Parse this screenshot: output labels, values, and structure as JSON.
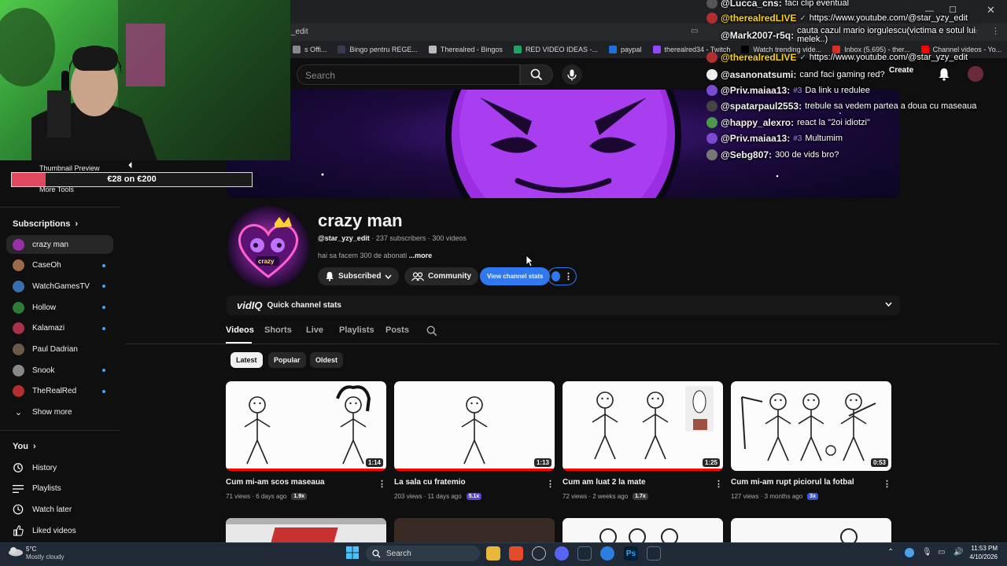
{
  "browser": {
    "tab_fragment": "_edit",
    "bookmarks": [
      {
        "label": "s Offi...",
        "color": "#888888"
      },
      {
        "label": "Bingo pentru REGE...",
        "color": "#3a3a55"
      },
      {
        "label": "Therealred - Bingos",
        "color": "#bbbbbb"
      },
      {
        "label": "RED VIDEO IDEAS -...",
        "color": "#1ea362"
      },
      {
        "label": "paypal",
        "color": "#1e6fd9"
      },
      {
        "label": "therealred34 - Twitch",
        "color": "#9146ff"
      },
      {
        "label": "Watch trending vide...",
        "color": "#000000"
      },
      {
        "label": "Inbox (5,695) - ther...",
        "color": "#d93025"
      },
      {
        "label": "Channel videos - Yo...",
        "color": "#ff0000"
      }
    ]
  },
  "header": {
    "search_placeholder": "Search",
    "create_label": "Create"
  },
  "chat": [
    {
      "user": "@Lucca_cns:",
      "msg": "faci clip eventual",
      "color": "#f1f1f1",
      "badge": ""
    },
    {
      "user": "@therealredLIVE",
      "msg": "https://www.youtube.com/@star_yzy_edit",
      "color": "#ffd400",
      "badge": "✓"
    },
    {
      "user": "@Mark2007-r5q:",
      "msg": "cauta cazul mario iorgulescu(victima e sotul lui melek..)",
      "color": "#f1f1f1",
      "badge": ""
    },
    {
      "user": "@therealredLIVE",
      "msg": "https://www.youtube.com/@star_yzy_edit",
      "color": "#ffd400",
      "badge": "✓"
    },
    {
      "user": "@asanonatsumi:",
      "msg": "cand faci gaming red?",
      "color": "#f1f1f1",
      "badge": ""
    },
    {
      "user": "@Priv.maiaa13:",
      "msg": "Da link u redulee",
      "color": "#f1f1f1",
      "badge": "#3"
    },
    {
      "user": "@spatarpaul2553:",
      "msg": "trebule sa vedem partea a doua cu maseaua",
      "color": "#f1f1f1",
      "badge": ""
    },
    {
      "user": "@happy_alexro:",
      "msg": "react la \"2oi idiotzi\"",
      "color": "#f1f1f1",
      "badge": ""
    },
    {
      "user": "@Priv.maiaa13:",
      "msg": "Multumim",
      "color": "#f1f1f1",
      "badge": "#3"
    },
    {
      "user": "@Sebg807:",
      "msg": "300 de vids bro?",
      "color": "#f1f1f1",
      "badge": ""
    }
  ],
  "overlay": {
    "thumbnail_preview": "Thumbnail Preview",
    "more_tools": "More Tools",
    "donation_text": "€28 on €200",
    "donation_fraction": 0.14
  },
  "sidebar": {
    "subscriptions_label": "Subscriptions",
    "subs": [
      {
        "name": "crazy man",
        "color": "#9a2fa8",
        "dot": false,
        "active": true
      },
      {
        "name": "CaseOh",
        "color": "#9a6a4a",
        "dot": true,
        "active": false
      },
      {
        "name": "WatchGamesTV",
        "color": "#3a6db0",
        "dot": true,
        "active": false
      },
      {
        "name": "Hollow",
        "color": "#2d7a3a",
        "dot": true,
        "active": false
      },
      {
        "name": "Kalamazi",
        "color": "#a8324a",
        "dot": true,
        "active": false
      },
      {
        "name": "Paul Dadrian",
        "color": "#6a5a4a",
        "dot": false,
        "active": false
      },
      {
        "name": "Snook",
        "color": "#888888",
        "dot": true,
        "active": false
      },
      {
        "name": "TheRealRed",
        "color": "#b03030",
        "dot": true,
        "active": false
      }
    ],
    "show_more": "Show more",
    "you_label": "You",
    "you_items": [
      {
        "label": "History",
        "icon": "history-icon"
      },
      {
        "label": "Playlists",
        "icon": "playlists-icon"
      },
      {
        "label": "Watch later",
        "icon": "clock-icon"
      },
      {
        "label": "Liked videos",
        "icon": "thumbs-up-icon"
      }
    ]
  },
  "channel": {
    "name": "crazy man",
    "handle": "@star_yzy_edit",
    "stats": " · 237 subscribers · 300 videos",
    "description": "hai sa facem 300 de abonati ",
    "more": "...more",
    "avatar_text": "crazy",
    "subscribed_label": "Subscribed",
    "community_label": "Community",
    "view_stats_label": "View channel stats"
  },
  "vidiq": {
    "logo": "vidIQ",
    "label": "Quick channel stats"
  },
  "tabs": [
    "Videos",
    "Shorts",
    "Live",
    "Playlists",
    "Posts"
  ],
  "filters": [
    "Latest",
    "Popular",
    "Oldest"
  ],
  "videos": [
    {
      "title": "Cum mi-am scos maseaua",
      "views": "71 views · 6 days ago",
      "badge": "1.9x",
      "badge_color": "#3a3a3a",
      "duration": "1:14",
      "progress": 1.0
    },
    {
      "title": "La sala cu fratemio",
      "views": "203 views · 11 days ago",
      "badge": "5.1x",
      "badge_color": "#5b3fd6",
      "duration": "1:13",
      "progress": 1.0
    },
    {
      "title": "Cum am luat 2 la mate",
      "views": "72 views · 2 weeks ago",
      "badge": "1.7x",
      "badge_color": "#3a3a3a",
      "duration": "1:25",
      "progress": 1.0
    },
    {
      "title": "Cum mi-am rupt piciorul la fotbal",
      "views": "127 views · 3 months ago",
      "badge": "3x",
      "badge_color": "#3b55d9",
      "duration": "0:53",
      "progress": 0
    }
  ],
  "taskbar": {
    "weather_temp": "5°C",
    "weather_desc": "Mostly cloudy",
    "search_label": "Search",
    "time": "11:53 PM",
    "date": "4/10/2026"
  }
}
